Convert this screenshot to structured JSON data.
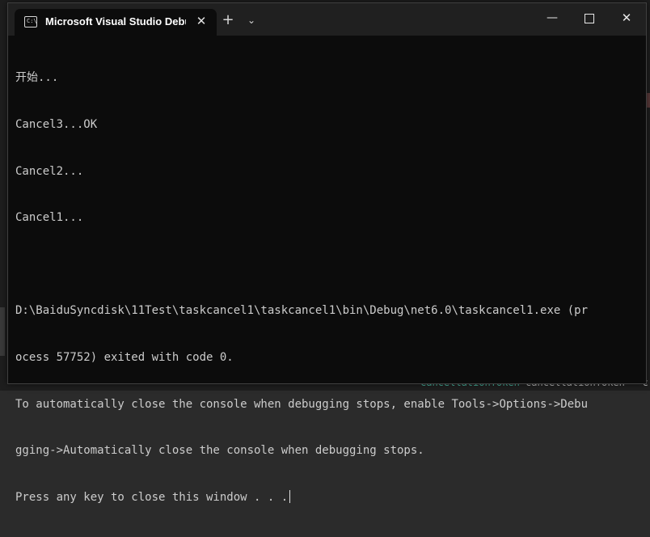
{
  "background": {
    "code_snippet_type": "CancellationToken",
    "code_snippet_rest": " cancellationToken = c"
  },
  "tab": {
    "title": "Microsoft Visual Studio Debug Console",
    "icon": "console-prompt-icon",
    "icon_text": "C:\\"
  },
  "titlebar": {
    "new_tab_glyph": "+",
    "dropdown_glyph": "⌄",
    "tab_close_glyph": "✕",
    "minimize_glyph": "—",
    "close_glyph": "✕"
  },
  "console": {
    "lines": [
      "开始...",
      "Cancel3...OK",
      "Cancel2...",
      "Cancel1...",
      "",
      "D:\\BaiduSyncdisk\\11Test\\taskcancel1\\taskcancel1\\bin\\Debug\\net6.0\\taskcancel1.exe (pr",
      "ocess 57752) exited with code 0.",
      "To automatically close the console when debugging stops, enable Tools->Options->Debu",
      "gging->Automatically close the console when debugging stops.",
      "Press any key to close this window . . ."
    ]
  },
  "colors": {
    "console_bg": "#0c0c0c",
    "console_text": "#cccccc",
    "titlebar_bg": "#202020"
  }
}
